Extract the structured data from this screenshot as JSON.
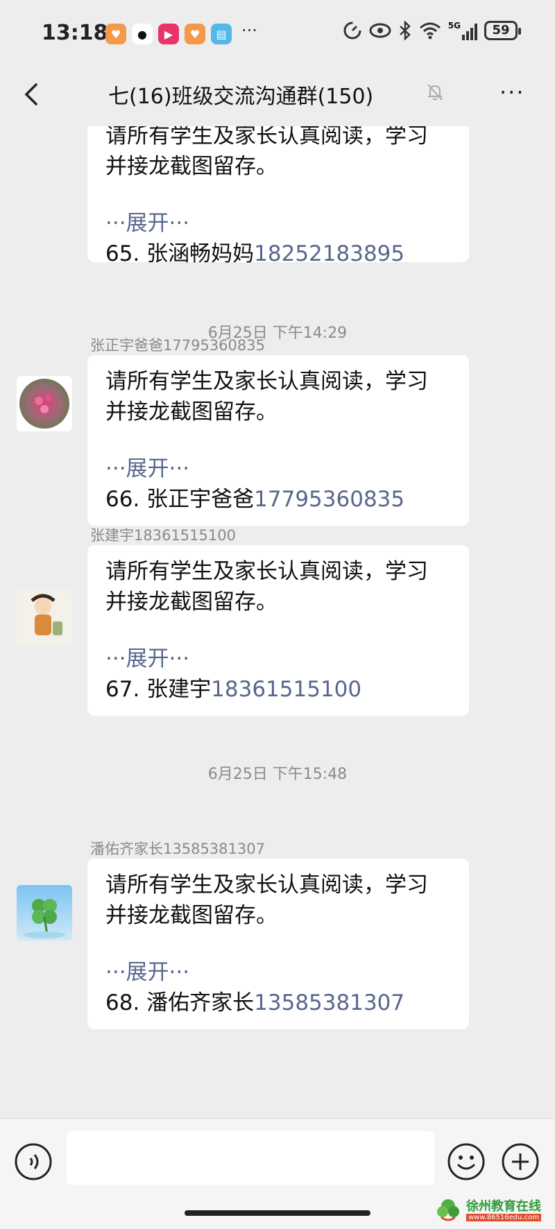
{
  "status_bar": {
    "time": "13:18",
    "more": "···",
    "network": "5G",
    "battery": "59"
  },
  "header": {
    "title": "七(16)班级交流沟通群(150)",
    "menu": "···"
  },
  "messages": [
    {
      "line1": "请所有学生及家长认真阅读，学习",
      "line2": "并接龙截图留存。",
      "expand": "···展开···",
      "entry_name": "65. 张涵畅妈妈",
      "entry_phone": "18252183895"
    },
    {
      "timestamp": "6月25日 下午14:29",
      "sender": "张正宇爸爸17795360835",
      "line1": "请所有学生及家长认真阅读，学习",
      "line2": "并接龙截图留存。",
      "expand": "···展开···",
      "entry_name": "66. 张正宇爸爸",
      "entry_phone": "17795360835"
    },
    {
      "sender": "张建宇18361515100",
      "line1": "请所有学生及家长认真阅读，学习",
      "line2": "并接龙截图留存。",
      "expand": "···展开···",
      "entry_name": "67. 张建宇",
      "entry_phone": "18361515100"
    },
    {
      "timestamp": "6月25日 下午15:48",
      "sender": "潘佑齐家长13585381307",
      "line1": "请所有学生及家长认真阅读，学习",
      "line2": "并接龙截图留存。",
      "expand": "···展开···",
      "entry_name": "68. 潘佑齐家长",
      "entry_phone": "13585381307"
    }
  ],
  "watermark": {
    "name": "徐州教育在线",
    "url": "www.86516edu.com"
  },
  "colors": {
    "background": "#ededed",
    "bubble": "#ffffff",
    "link": "#57678c",
    "meta_text": "#8a8a8a"
  }
}
